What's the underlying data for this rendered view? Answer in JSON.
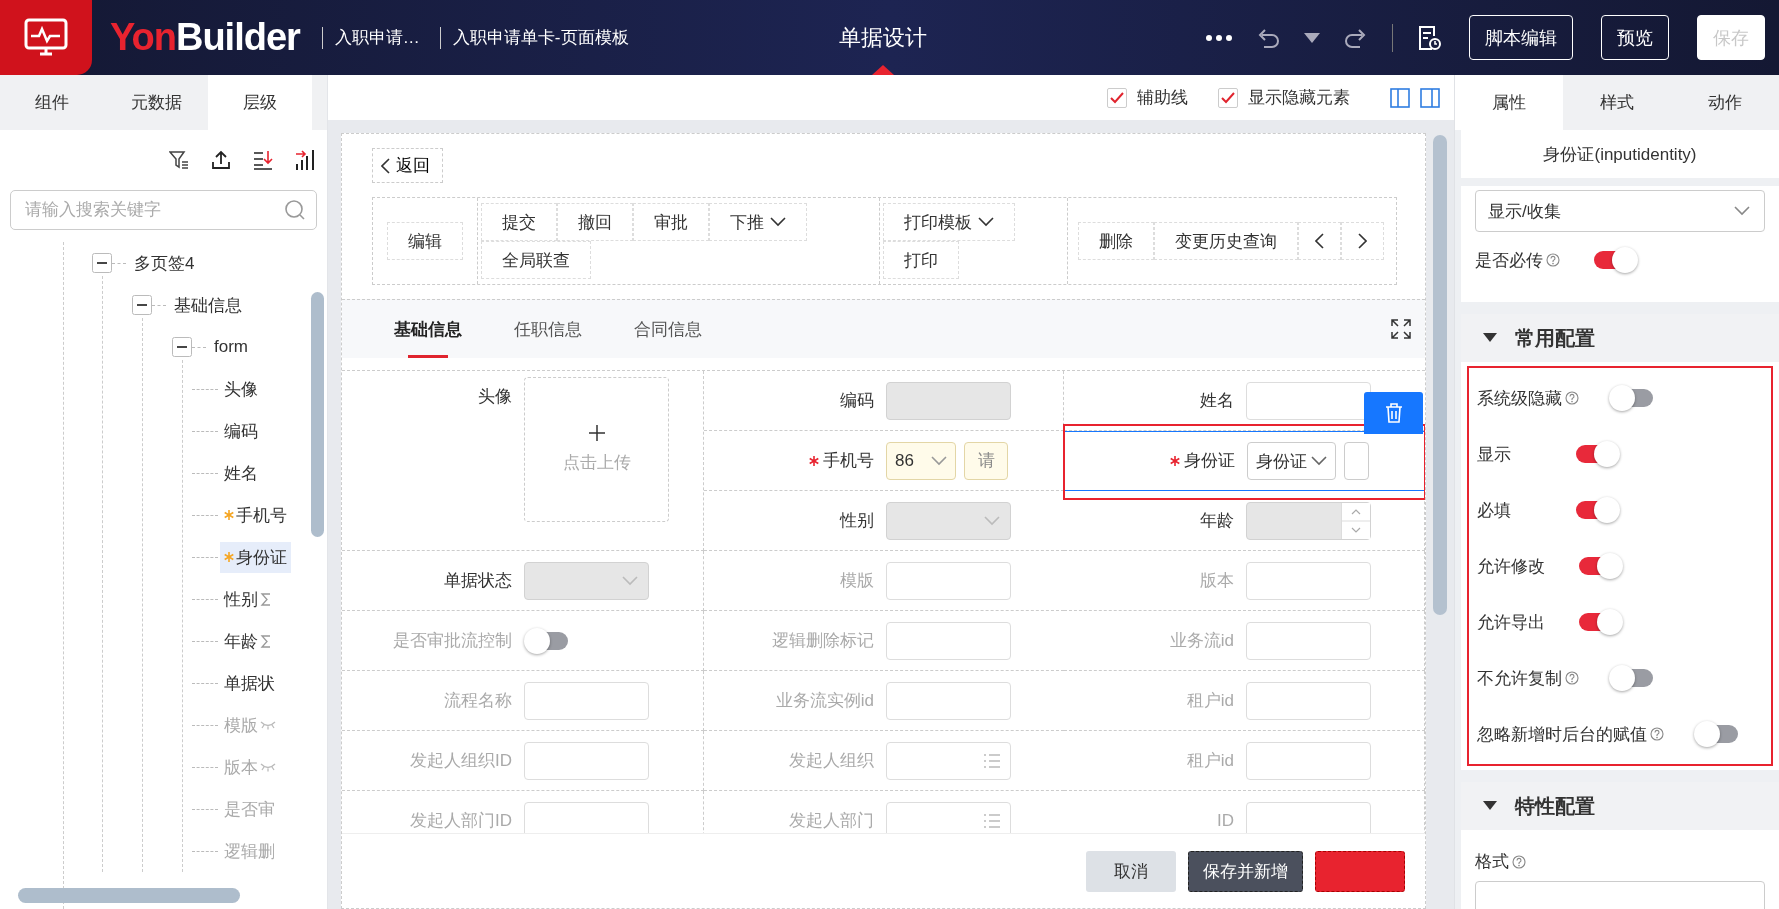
{
  "header": {
    "brand": {
      "lead": "Yon",
      "rest": "Builder"
    },
    "breadcrumbs": [
      "入职申请…",
      "入职申请单卡-页面模板"
    ],
    "title": "单据设计",
    "buttons": [
      {
        "label": "脚本编辑",
        "disabled": false
      },
      {
        "label": "预览",
        "disabled": false
      },
      {
        "label": "保存",
        "disabled": true
      }
    ]
  },
  "left_panel": {
    "tabs": [
      {
        "label": "组件",
        "selected": false
      },
      {
        "label": "元数据",
        "selected": false
      },
      {
        "label": "层级",
        "selected": true
      }
    ],
    "search": {
      "placeholder": "请输入搜索关键字"
    },
    "tree": [
      {
        "label": "多页签4",
        "expanded": true,
        "selected": false,
        "children": [
          {
            "label": "基础信息",
            "expanded": true,
            "selected": false,
            "children": [
              {
                "label": "form",
                "expanded": true,
                "selected": false,
                "children": [
                  {
                    "label": "头像",
                    "kind": "plain",
                    "required": false,
                    "hidden": false,
                    "selected": false
                  },
                  {
                    "label": "编码",
                    "kind": "plain",
                    "required": false,
                    "hidden": false,
                    "selected": false
                  },
                  {
                    "label": "姓名",
                    "kind": "plain",
                    "required": false,
                    "hidden": false,
                    "selected": false
                  },
                  {
                    "label": "手机号",
                    "kind": "plain",
                    "required": true,
                    "hidden": false,
                    "selected": false
                  },
                  {
                    "label": "身份证",
                    "kind": "plain",
                    "required": true,
                    "hidden": false,
                    "selected": true
                  },
                  {
                    "label": "性别",
                    "kind": "sum",
                    "required": false,
                    "hidden": false,
                    "selected": false
                  },
                  {
                    "label": "年龄",
                    "kind": "sum",
                    "required": false,
                    "hidden": false,
                    "selected": false
                  },
                  {
                    "label": "单据状",
                    "kind": "plain",
                    "required": false,
                    "hidden": false,
                    "selected": false
                  },
                  {
                    "label": "模版",
                    "kind": "eye-off",
                    "required": false,
                    "hidden": true,
                    "selected": false
                  },
                  {
                    "label": "版本",
                    "kind": "eye-off",
                    "required": false,
                    "hidden": true,
                    "selected": false
                  },
                  {
                    "label": "是否审",
                    "kind": "plain",
                    "required": false,
                    "hidden": true,
                    "selected": false
                  },
                  {
                    "label": "逻辑删",
                    "kind": "plain",
                    "required": false,
                    "hidden": true,
                    "selected": false
                  }
                ]
              }
            ]
          }
        ]
      }
    ]
  },
  "canvas": {
    "checkboxes": [
      {
        "label": "辅助线",
        "checked": true
      },
      {
        "label": "显示隐藏元素",
        "checked": true
      }
    ],
    "back_button": "返回",
    "button_groups": [
      {
        "rows": [
          [
            {
              "kind": "button",
              "label": "编辑",
              "dropdown": false
            }
          ]
        ]
      },
      {
        "rows": [
          [
            {
              "kind": "button",
              "label": "提交",
              "dropdown": false
            },
            {
              "kind": "button",
              "label": "撤回",
              "dropdown": false
            },
            {
              "kind": "button",
              "label": "审批",
              "dropdown": false
            },
            {
              "kind": "button",
              "label": "下推",
              "dropdown": true
            }
          ],
          [
            {
              "kind": "button",
              "label": "全局联查",
              "dropdown": false
            }
          ]
        ]
      },
      {
        "rows": [
          [
            {
              "kind": "button",
              "label": "打印模板",
              "dropdown": true
            }
          ],
          [
            {
              "kind": "button",
              "label": "打印",
              "dropdown": false
            }
          ]
        ]
      },
      {
        "rows": [
          [
            {
              "kind": "button",
              "label": "删除",
              "dropdown": false
            },
            {
              "kind": "button",
              "label": "变更历史查询",
              "dropdown": false
            },
            {
              "kind": "prev"
            },
            {
              "kind": "next"
            }
          ]
        ]
      }
    ],
    "tabs": [
      {
        "label": "基础信息",
        "selected": true
      },
      {
        "label": "任职信息",
        "selected": false
      },
      {
        "label": "合同信息",
        "selected": false
      }
    ],
    "form": [
      {
        "label": "头像",
        "kind": "upload",
        "hint": "点击上传",
        "required": false,
        "hidden": false,
        "disabled": false,
        "selected": false
      },
      {
        "label": "编码",
        "kind": "input",
        "required": false,
        "hidden": false,
        "disabled": true,
        "selected": false
      },
      {
        "label": "姓名",
        "kind": "input",
        "required": false,
        "hidden": false,
        "disabled": false,
        "selected": false
      },
      {
        "label": "手机号",
        "kind": "phone",
        "code": "86",
        "placeholder": "请",
        "required": true,
        "hidden": false,
        "disabled": false,
        "selected": false
      },
      {
        "label": "身份证",
        "kind": "idcard",
        "value": "身份证",
        "required": true,
        "hidden": false,
        "disabled": false,
        "selected": true
      },
      {
        "label": "性别",
        "kind": "select",
        "required": false,
        "hidden": false,
        "disabled": true,
        "selected": false
      },
      {
        "label": "年龄",
        "kind": "number",
        "required": false,
        "hidden": false,
        "disabled": true,
        "selected": false
      },
      {
        "label": "单据状态",
        "kind": "select",
        "required": false,
        "hidden": false,
        "disabled": true,
        "selected": false
      },
      {
        "label": "模版",
        "kind": "input",
        "required": false,
        "hidden": true,
        "disabled": false,
        "selected": false
      },
      {
        "label": "版本",
        "kind": "input",
        "required": false,
        "hidden": true,
        "disabled": false,
        "selected": false
      },
      {
        "label": "是否审批流控制",
        "kind": "toggle",
        "on": false,
        "required": false,
        "hidden": true,
        "disabled": false,
        "selected": false
      },
      {
        "label": "逻辑删除标记",
        "kind": "input",
        "required": false,
        "hidden": true,
        "disabled": false,
        "selected": false
      },
      {
        "label": "业务流id",
        "kind": "input",
        "required": false,
        "hidden": true,
        "disabled": false,
        "selected": false
      },
      {
        "label": "流程名称",
        "kind": "input",
        "required": false,
        "hidden": true,
        "disabled": false,
        "selected": false
      },
      {
        "label": "业务流实例id",
        "kind": "input",
        "required": false,
        "hidden": true,
        "disabled": false,
        "selected": false
      },
      {
        "label": "租户id",
        "kind": "input",
        "required": false,
        "hidden": true,
        "disabled": false,
        "selected": false
      },
      {
        "label": "发起人组织ID",
        "kind": "input",
        "required": false,
        "hidden": true,
        "disabled": false,
        "selected": false
      },
      {
        "label": "发起人组织",
        "kind": "ref",
        "required": false,
        "hidden": true,
        "disabled": false,
        "selected": false
      },
      {
        "label": "租户id",
        "kind": "input",
        "required": false,
        "hidden": true,
        "disabled": false,
        "selected": false
      },
      {
        "label": "发起人部门ID",
        "kind": "input",
        "required": false,
        "hidden": true,
        "disabled": false,
        "selected": false
      },
      {
        "label": "发起人部门",
        "kind": "ref",
        "required": false,
        "hidden": true,
        "disabled": false,
        "selected": false
      },
      {
        "label": "ID",
        "kind": "input",
        "required": false,
        "hidden": true,
        "disabled": false,
        "selected": false
      }
    ],
    "footer_buttons": [
      {
        "kind": "plain",
        "label": "取消"
      },
      {
        "kind": "dark",
        "label": "保存并新增"
      },
      {
        "kind": "primary"
      }
    ]
  },
  "right_panel": {
    "tabs": [
      {
        "label": "属性",
        "selected": true
      },
      {
        "label": "样式",
        "selected": false
      },
      {
        "label": "动作",
        "selected": false
      }
    ],
    "title": "身份证(inputidentity)",
    "mode_select": "显示/收集",
    "top_items": [
      {
        "kind": "toggle",
        "label": "是否必传",
        "help": true,
        "on": true
      }
    ],
    "sections": [
      {
        "title": "常用配置",
        "expanded": true,
        "highlighted": true,
        "items": [
          {
            "kind": "toggle",
            "label": "系统级隐藏",
            "help": true,
            "on": false
          },
          {
            "kind": "toggle",
            "label": "显示",
            "help": false,
            "on": true
          },
          {
            "kind": "toggle",
            "label": "必填",
            "help": false,
            "on": true
          },
          {
            "kind": "toggle",
            "label": "允许修改",
            "help": false,
            "on": true
          },
          {
            "kind": "toggle",
            "label": "允许导出",
            "help": false,
            "on": true
          },
          {
            "kind": "toggle",
            "label": "不允许复制",
            "help": true,
            "on": false
          },
          {
            "kind": "toggle",
            "label": "忽略新增时后台的赋值",
            "help": true,
            "on": false
          }
        ]
      },
      {
        "title": "特性配置",
        "expanded": true,
        "highlighted": false,
        "items": [
          {
            "kind": "input",
            "label": "格式",
            "help": true
          }
        ]
      }
    ]
  }
}
